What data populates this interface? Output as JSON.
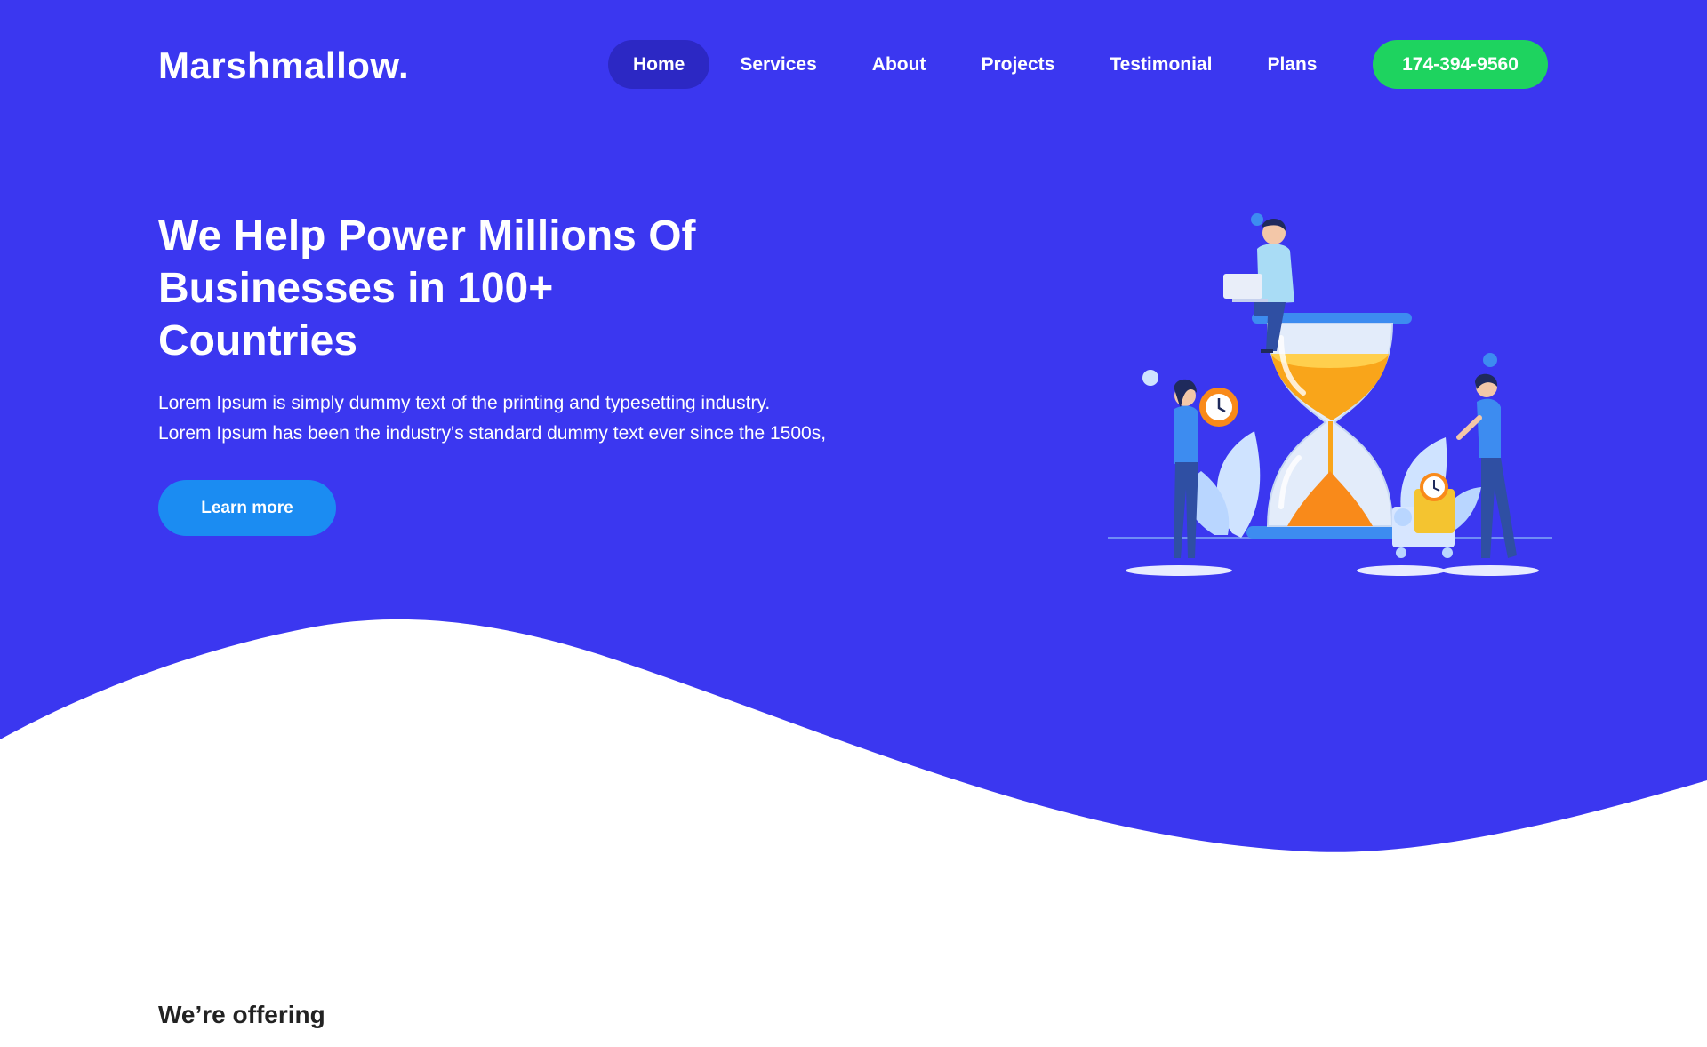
{
  "brand": {
    "logo_text": "Marshmallow."
  },
  "nav": {
    "items": [
      {
        "label": "Home",
        "active": true
      },
      {
        "label": "Services",
        "active": false
      },
      {
        "label": "About",
        "active": false
      },
      {
        "label": "Projects",
        "active": false
      },
      {
        "label": "Testimonial",
        "active": false
      },
      {
        "label": "Plans",
        "active": false
      }
    ],
    "phone": "174-394-9560"
  },
  "hero": {
    "title": "We Help Power Millions Of Businesses in 100+ Countries",
    "description_line1": "Lorem Ipsum is simply dummy text of the printing and typesetting industry.",
    "description_line2": "Lorem Ipsum has been the industry's standard dummy text ever since the 1500s,",
    "cta_label": "Learn more",
    "illustration_icon": "hourglass-team-illustration"
  },
  "offering": {
    "heading": "We’re offering"
  },
  "colors": {
    "hero_bg": "#3b37f0",
    "active_nav": "#2c28c4",
    "phone_button": "#1ed35f",
    "cta_button": "#1b8cf2",
    "hourglass_sand": "#f9a51a"
  }
}
